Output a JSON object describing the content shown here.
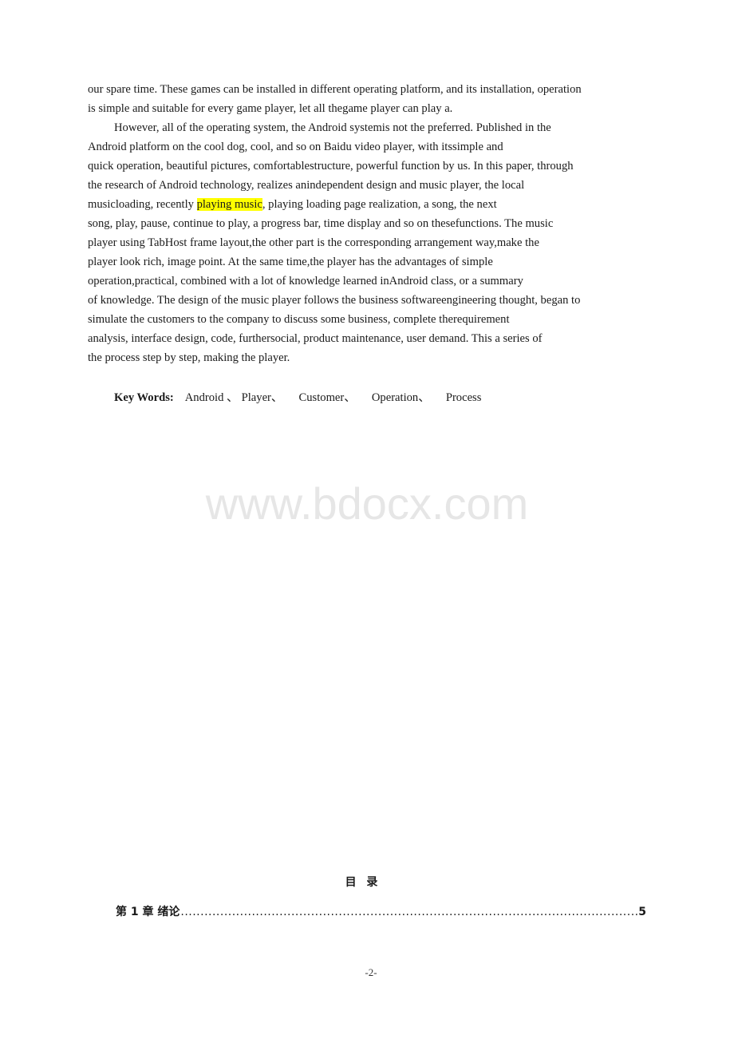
{
  "abstract": {
    "lines": [
      "our spare time. These games can be installed in different operating platform, and its installation, operation",
      "is simple and suitable for every game player, let all thegame player can play a.",
      "However, all of the operating system, the Android systemis not the preferred. Published in the",
      "Android platform on the cool dog, cool, and so on Baidu video player, with itssimple and",
      "quick operation, beautiful pictures, comfortablestructure, powerful function by us. In this paper, through",
      "the research of Android technology, realizes anindependent design and music player, the local",
      "musicloading, recently ",
      "song, play, pause, continue to play, a progress bar, time display and so on thesefunctions. The music",
      "player using TabHost frame layout,the other part is the corresponding arrangement way,make the",
      "player look rich, image point. At the same time,the player has the advantages of simple",
      "operation,practical, combined with a lot of knowledge learned inAndroid class, or a summary",
      "of knowledge. The design of the music player follows the business softwareengineering thought, began to",
      "simulate the customers to the company to discuss some business, complete therequirement",
      "analysis, interface design, code, furthersocial, product maintenance, user demand. This a series of",
      "the process step by step, making the player."
    ],
    "highlighted_text": "playing music",
    "after_highlight": ", playing loading page realization, a song, the next",
    "highlight_color": "#ffff00"
  },
  "keywords": {
    "label": "Key Words:",
    "items": [
      "Android 、",
      "Player、",
      "Customer、",
      "Operation、",
      "Process"
    ]
  },
  "watermark": "www.bdocx.com",
  "toc": {
    "title": "目 录",
    "entries": [
      {
        "label": "第 1 章  绪论",
        "page": "5"
      }
    ]
  },
  "page_number": "-2-"
}
